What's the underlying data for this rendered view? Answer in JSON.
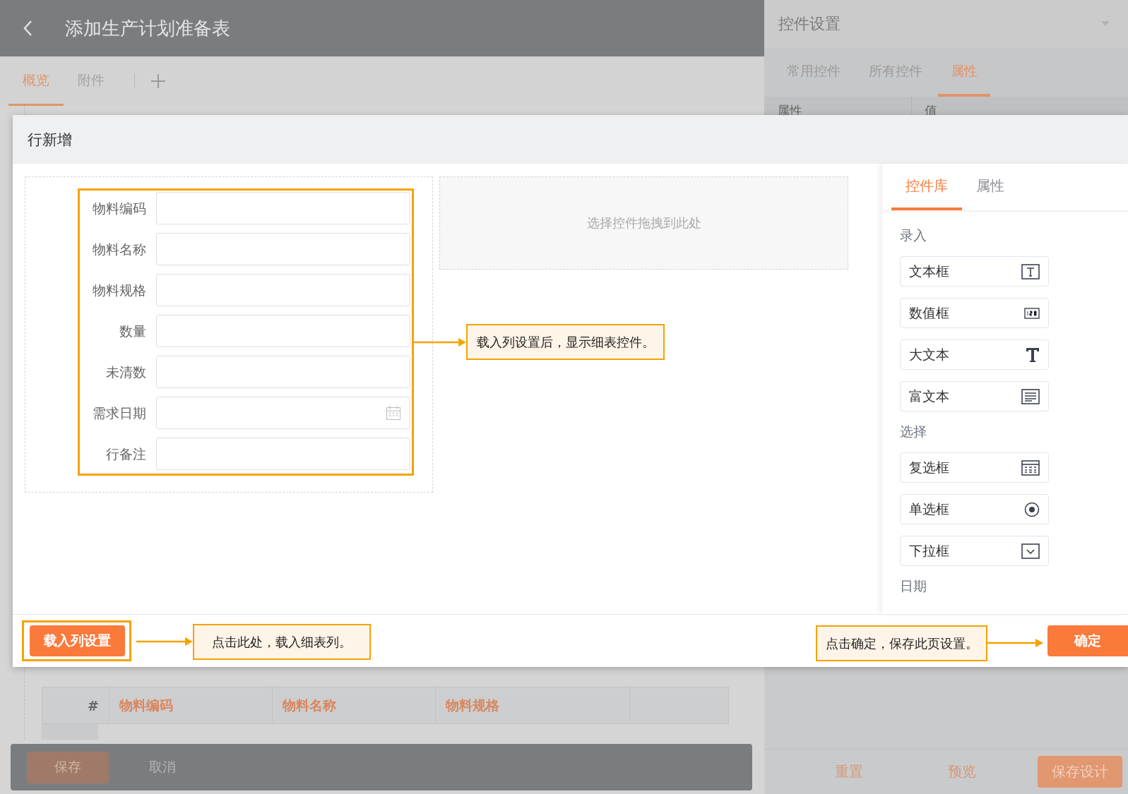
{
  "app": {
    "title": "添加生产计划准备表",
    "tabs": [
      {
        "label": "概览",
        "selected": true
      },
      {
        "label": "附件",
        "selected": false
      }
    ]
  },
  "detail": {
    "columns": [
      "#",
      "物料编码",
      "物料名称",
      "物料规格"
    ]
  },
  "bottom_bar": {
    "buttons": [
      {
        "label": "保存",
        "kind": "primary"
      },
      {
        "label": "取消",
        "kind": "plain"
      }
    ]
  },
  "side_panel": {
    "title": "控件设置",
    "tabs": [
      {
        "label": "常用控件",
        "selected": false
      },
      {
        "label": "所有控件",
        "selected": false
      },
      {
        "label": "属性",
        "selected": true
      }
    ],
    "columns": [
      "属性",
      "值"
    ],
    "buttons": [
      {
        "label": "重置",
        "kind": "plain"
      },
      {
        "label": "预览",
        "kind": "plain"
      },
      {
        "label": "保存设计",
        "kind": "primary"
      }
    ]
  },
  "dialog": {
    "title": "行新增",
    "fields": [
      {
        "label": "物料编码",
        "kind": "text"
      },
      {
        "label": "物料名称",
        "kind": "text"
      },
      {
        "label": "物料规格",
        "kind": "text"
      },
      {
        "label": "数量",
        "kind": "text"
      },
      {
        "label": "未清数",
        "kind": "text"
      },
      {
        "label": "需求日期",
        "kind": "date"
      },
      {
        "label": "行备注",
        "kind": "text"
      }
    ],
    "drop_hint": "选择控件拖拽到此处",
    "library_tabs": [
      {
        "label": "控件库",
        "selected": true
      },
      {
        "label": "属性",
        "selected": false
      }
    ],
    "groups": [
      {
        "title": "录入",
        "items": [
          {
            "label": "文本框",
            "kind": "text"
          },
          {
            "label": "数值框",
            "kind": "number"
          },
          {
            "label": "大文本",
            "kind": "bigtext"
          },
          {
            "label": "富文本",
            "kind": "rich"
          }
        ]
      },
      {
        "title": "选择",
        "items": [
          {
            "label": "复选框",
            "kind": "checkbox"
          },
          {
            "label": "单选框",
            "kind": "radio"
          },
          {
            "label": "下拉框",
            "kind": "select"
          }
        ]
      },
      {
        "title": "日期"
      }
    ],
    "load_button": "载入列设置",
    "confirm_button": "确定"
  },
  "annotations": [
    {
      "kind": "form",
      "text": "载入列设置后，显示细表控件。"
    },
    {
      "kind": "load",
      "text": "点击此处，载入细表列。"
    },
    {
      "kind": "confirm",
      "text": "点击确定，保存此页设置。"
    }
  ]
}
